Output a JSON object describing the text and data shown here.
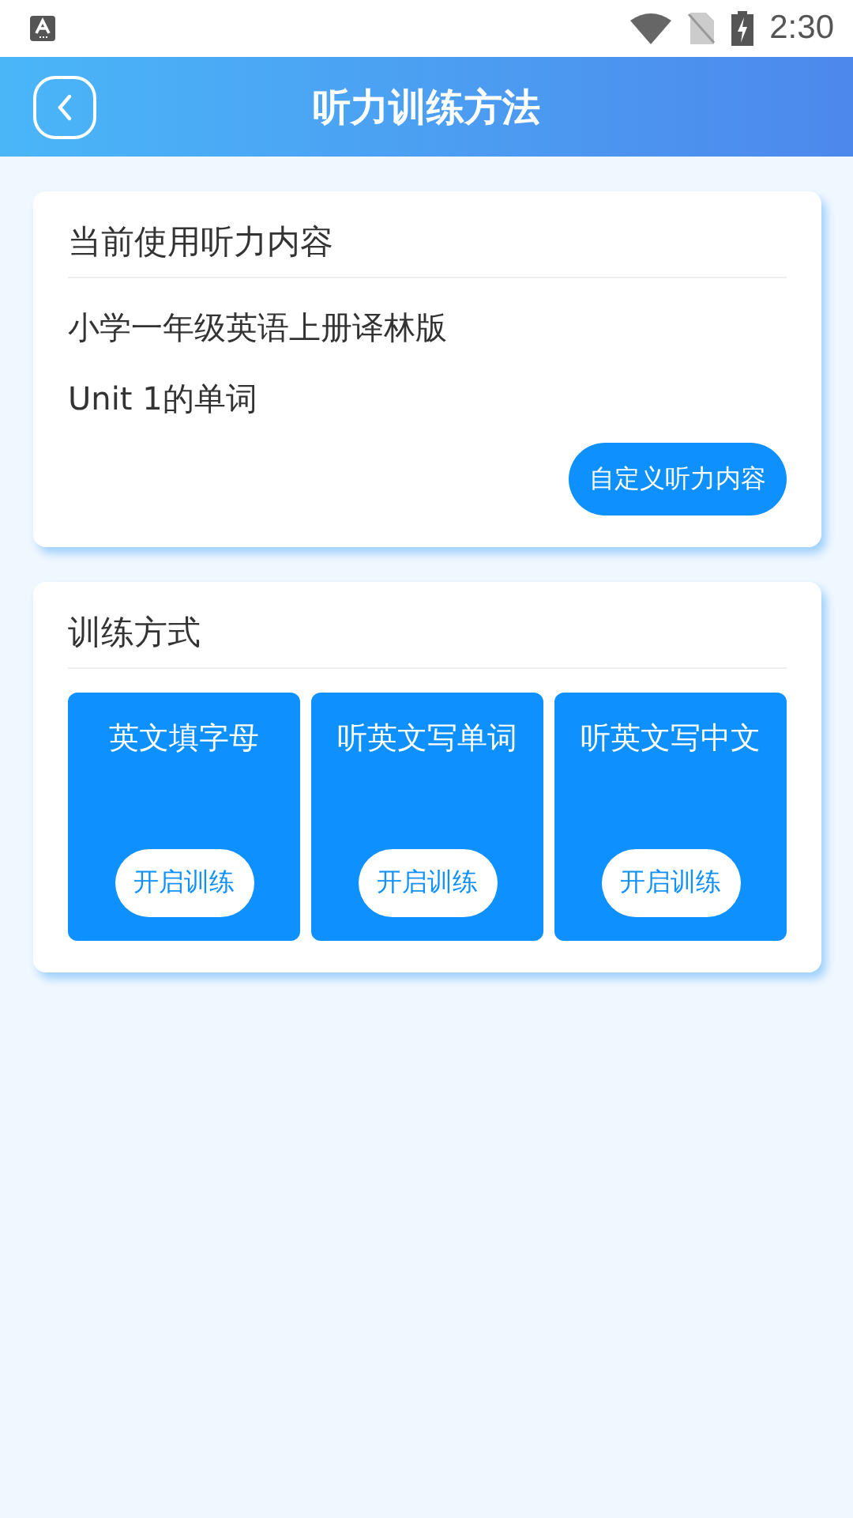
{
  "status_bar": {
    "time": "2:30"
  },
  "header": {
    "title": "听力训练方法"
  },
  "current_content": {
    "title": "当前使用听力内容",
    "lines": [
      "小学一年级英语上册译林版",
      "Unit 1的单词"
    ],
    "button": "自定义听力内容"
  },
  "training": {
    "title": "训练方式",
    "modes": [
      {
        "label": "英文填字母",
        "button": "开启训练"
      },
      {
        "label": "听英文写单词",
        "button": "开启训练"
      },
      {
        "label": "听英文写中文",
        "button": "开启训练"
      }
    ]
  }
}
